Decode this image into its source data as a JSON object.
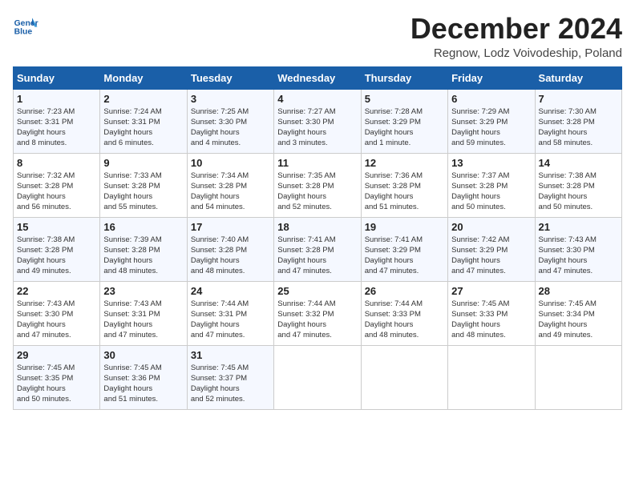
{
  "logo": {
    "line1": "General",
    "line2": "Blue"
  },
  "title": "December 2024",
  "subtitle": "Regnow, Lodz Voivodeship, Poland",
  "weekdays": [
    "Sunday",
    "Monday",
    "Tuesday",
    "Wednesday",
    "Thursday",
    "Friday",
    "Saturday"
  ],
  "weeks": [
    [
      {
        "day": "1",
        "sunrise": "7:23 AM",
        "sunset": "3:31 PM",
        "daylight": "8 hours and 8 minutes."
      },
      {
        "day": "2",
        "sunrise": "7:24 AM",
        "sunset": "3:31 PM",
        "daylight": "8 hours and 6 minutes."
      },
      {
        "day": "3",
        "sunrise": "7:25 AM",
        "sunset": "3:30 PM",
        "daylight": "8 hours and 4 minutes."
      },
      {
        "day": "4",
        "sunrise": "7:27 AM",
        "sunset": "3:30 PM",
        "daylight": "8 hours and 3 minutes."
      },
      {
        "day": "5",
        "sunrise": "7:28 AM",
        "sunset": "3:29 PM",
        "daylight": "8 hours and 1 minute."
      },
      {
        "day": "6",
        "sunrise": "7:29 AM",
        "sunset": "3:29 PM",
        "daylight": "7 hours and 59 minutes."
      },
      {
        "day": "7",
        "sunrise": "7:30 AM",
        "sunset": "3:28 PM",
        "daylight": "7 hours and 58 minutes."
      }
    ],
    [
      {
        "day": "8",
        "sunrise": "7:32 AM",
        "sunset": "3:28 PM",
        "daylight": "7 hours and 56 minutes."
      },
      {
        "day": "9",
        "sunrise": "7:33 AM",
        "sunset": "3:28 PM",
        "daylight": "7 hours and 55 minutes."
      },
      {
        "day": "10",
        "sunrise": "7:34 AM",
        "sunset": "3:28 PM",
        "daylight": "7 hours and 54 minutes."
      },
      {
        "day": "11",
        "sunrise": "7:35 AM",
        "sunset": "3:28 PM",
        "daylight": "7 hours and 52 minutes."
      },
      {
        "day": "12",
        "sunrise": "7:36 AM",
        "sunset": "3:28 PM",
        "daylight": "7 hours and 51 minutes."
      },
      {
        "day": "13",
        "sunrise": "7:37 AM",
        "sunset": "3:28 PM",
        "daylight": "7 hours and 50 minutes."
      },
      {
        "day": "14",
        "sunrise": "7:38 AM",
        "sunset": "3:28 PM",
        "daylight": "7 hours and 50 minutes."
      }
    ],
    [
      {
        "day": "15",
        "sunrise": "7:38 AM",
        "sunset": "3:28 PM",
        "daylight": "7 hours and 49 minutes."
      },
      {
        "day": "16",
        "sunrise": "7:39 AM",
        "sunset": "3:28 PM",
        "daylight": "7 hours and 48 minutes."
      },
      {
        "day": "17",
        "sunrise": "7:40 AM",
        "sunset": "3:28 PM",
        "daylight": "7 hours and 48 minutes."
      },
      {
        "day": "18",
        "sunrise": "7:41 AM",
        "sunset": "3:28 PM",
        "daylight": "7 hours and 47 minutes."
      },
      {
        "day": "19",
        "sunrise": "7:41 AM",
        "sunset": "3:29 PM",
        "daylight": "7 hours and 47 minutes."
      },
      {
        "day": "20",
        "sunrise": "7:42 AM",
        "sunset": "3:29 PM",
        "daylight": "7 hours and 47 minutes."
      },
      {
        "day": "21",
        "sunrise": "7:43 AM",
        "sunset": "3:30 PM",
        "daylight": "7 hours and 47 minutes."
      }
    ],
    [
      {
        "day": "22",
        "sunrise": "7:43 AM",
        "sunset": "3:30 PM",
        "daylight": "7 hours and 47 minutes."
      },
      {
        "day": "23",
        "sunrise": "7:43 AM",
        "sunset": "3:31 PM",
        "daylight": "7 hours and 47 minutes."
      },
      {
        "day": "24",
        "sunrise": "7:44 AM",
        "sunset": "3:31 PM",
        "daylight": "7 hours and 47 minutes."
      },
      {
        "day": "25",
        "sunrise": "7:44 AM",
        "sunset": "3:32 PM",
        "daylight": "7 hours and 47 minutes."
      },
      {
        "day": "26",
        "sunrise": "7:44 AM",
        "sunset": "3:33 PM",
        "daylight": "7 hours and 48 minutes."
      },
      {
        "day": "27",
        "sunrise": "7:45 AM",
        "sunset": "3:33 PM",
        "daylight": "7 hours and 48 minutes."
      },
      {
        "day": "28",
        "sunrise": "7:45 AM",
        "sunset": "3:34 PM",
        "daylight": "7 hours and 49 minutes."
      }
    ],
    [
      {
        "day": "29",
        "sunrise": "7:45 AM",
        "sunset": "3:35 PM",
        "daylight": "7 hours and 50 minutes."
      },
      {
        "day": "30",
        "sunrise": "7:45 AM",
        "sunset": "3:36 PM",
        "daylight": "7 hours and 51 minutes."
      },
      {
        "day": "31",
        "sunrise": "7:45 AM",
        "sunset": "3:37 PM",
        "daylight": "7 hours and 52 minutes."
      },
      null,
      null,
      null,
      null
    ]
  ]
}
